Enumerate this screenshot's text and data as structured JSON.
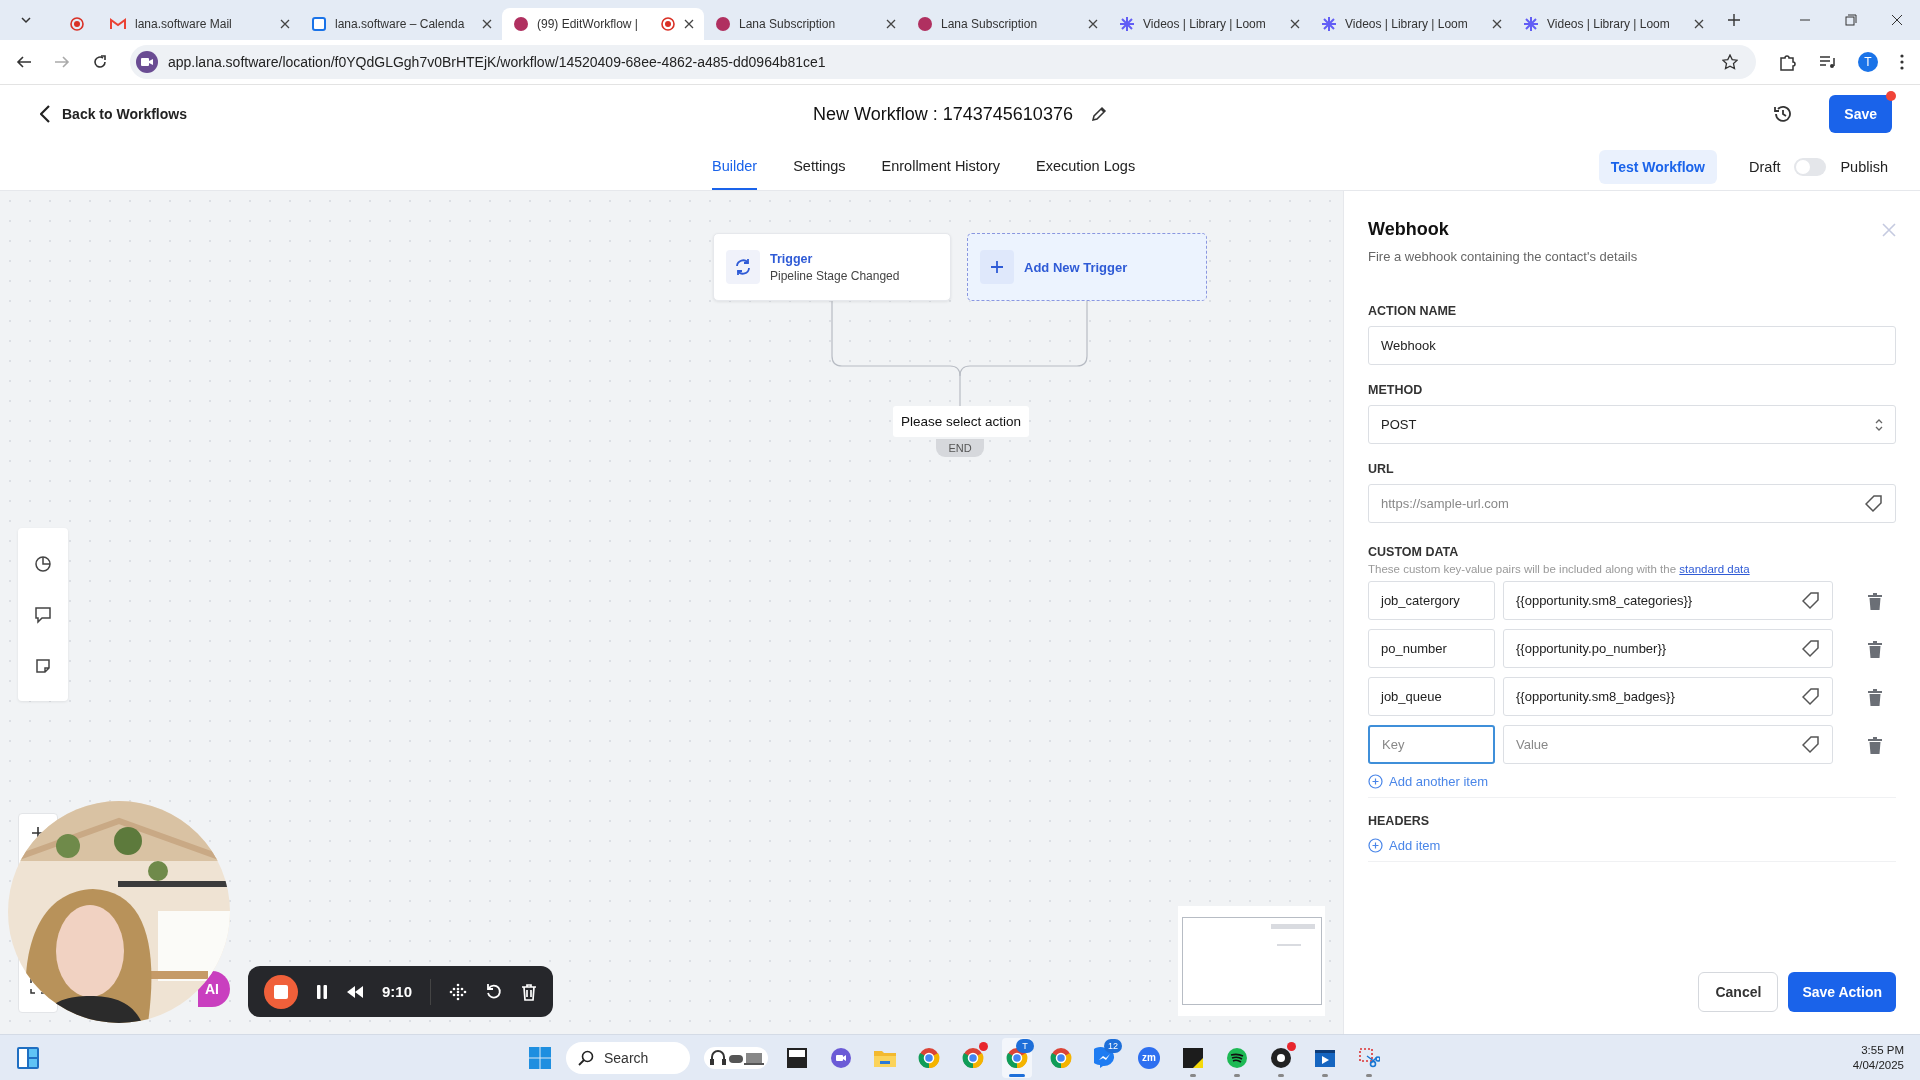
{
  "browser": {
    "tabs": [
      {
        "kind": "record",
        "selected": false,
        "recording": false
      },
      {
        "kind": "mail",
        "title": "lana.software Mail",
        "selected": false,
        "recording": false
      },
      {
        "kind": "calendar",
        "title": "lana.software – Calenda",
        "selected": false,
        "recording": false
      },
      {
        "kind": "app",
        "title": "(99) EditWorkflow |",
        "selected": true,
        "recording": true
      },
      {
        "kind": "subscription",
        "title": "Lana Subscription",
        "selected": false,
        "recording": false
      },
      {
        "kind": "subscription",
        "title": "Lana Subscription",
        "selected": false,
        "recording": false
      },
      {
        "kind": "loom",
        "title": "Videos | Library | Loom",
        "selected": false,
        "recording": false
      },
      {
        "kind": "loom",
        "title": "Videos | Library | Loom",
        "selected": false,
        "recording": false
      },
      {
        "kind": "loom",
        "title": "Videos | Library | Loom",
        "selected": false,
        "recording": false
      }
    ],
    "address": "app.lana.software/location/f0YQdGLGgh7v0BrHTEjK/workflow/14520409-68ee-4862-a485-dd0964b81ce1",
    "profile": "T"
  },
  "header": {
    "back": "Back to Workflows",
    "title": "New Workflow : 1743745610376",
    "save": "Save",
    "save_notification": true
  },
  "nav": {
    "tabs": [
      {
        "label": "Builder",
        "selected": true
      },
      {
        "label": "Settings",
        "selected": false
      },
      {
        "label": "Enrollment History",
        "selected": false
      },
      {
        "label": "Execution Logs",
        "selected": false
      }
    ],
    "test_button": "Test Workflow",
    "draft_label": "Draft",
    "publish_on": false,
    "publish_label": "Publish"
  },
  "canvas": {
    "trigger": {
      "label": "Trigger",
      "event": "Pipeline Stage Changed"
    },
    "add_trigger": "Add New Trigger",
    "action_prompt": "Please select action",
    "end_label": "END",
    "ai_badge": "AI",
    "recorder": {
      "time": "9:10"
    }
  },
  "panel": {
    "title": "Webhook",
    "subtitle": "Fire a webhook containing the contact's details",
    "fields": [
      {
        "kind": "text",
        "label": "ACTION NAME",
        "value": "Webhook"
      },
      {
        "kind": "select",
        "label": "METHOD",
        "value": "POST"
      },
      {
        "kind": "tag",
        "label": "URL",
        "placeholder": "https://sample-url.com"
      }
    ],
    "custom_data": {
      "label": "CUSTOM DATA",
      "help": "These custom key-value pairs will be included along with the",
      "help_link": "standard data",
      "rows": [
        {
          "key": "job_catergory",
          "value": "{{opportunity.sm8_categories}}",
          "focused": false
        },
        {
          "key": "po_number",
          "value": "{{opportunity.po_number}}",
          "focused": false
        },
        {
          "key": "job_queue",
          "value": "{{opportunity.sm8_badges}}",
          "focused": false
        },
        {
          "key_placeholder": "Key",
          "value_placeholder": "Value",
          "focused": true
        }
      ],
      "add": "Add another item"
    },
    "headers": {
      "label": "HEADERS",
      "add": "Add item"
    },
    "cancel": "Cancel",
    "save": "Save Action"
  },
  "taskbar": {
    "search": "Search",
    "apps": [
      {
        "kind": "widgets",
        "selected": false,
        "running": false,
        "alert": false
      },
      {
        "kind": "window",
        "selected": false,
        "running": false,
        "alert": false
      },
      {
        "kind": "video-chat",
        "selected": false,
        "running": false,
        "alert": false
      },
      {
        "kind": "folder",
        "selected": false,
        "running": false,
        "alert": false
      },
      {
        "kind": "ring",
        "selected": false,
        "running": false,
        "alert": false
      },
      {
        "kind": "ring",
        "selected": false,
        "running": false,
        "alert": true
      },
      {
        "kind": "ring",
        "selected": true,
        "running": true,
        "alert": false,
        "badge": "T"
      },
      {
        "kind": "ring",
        "selected": false,
        "running": false,
        "alert": false
      },
      {
        "kind": "messenger",
        "selected": false,
        "running": false,
        "alert": false,
        "badge": "12"
      },
      {
        "kind": "zoom",
        "label": "zm",
        "selected": false,
        "running": false,
        "alert": false
      },
      {
        "kind": "note",
        "selected": false,
        "running": true,
        "alert": false
      },
      {
        "kind": "music",
        "selected": false,
        "running": true,
        "alert": false
      },
      {
        "kind": "record",
        "selected": false,
        "running": true,
        "alert": true
      },
      {
        "kind": "player",
        "selected": false,
        "running": true,
        "alert": false
      },
      {
        "kind": "snip",
        "selected": false,
        "running": true,
        "alert": false
      }
    ],
    "time": "3:55 PM",
    "date": "4/04/2025"
  }
}
